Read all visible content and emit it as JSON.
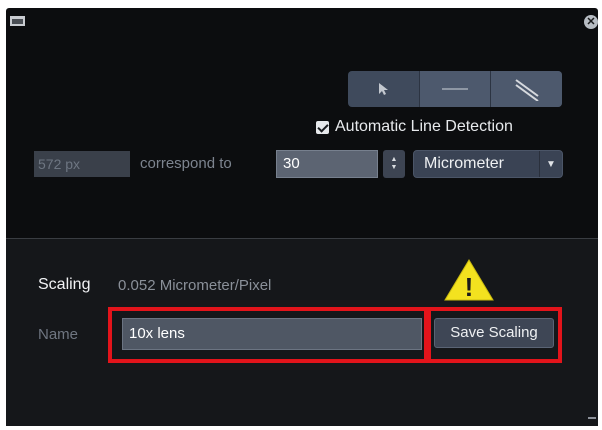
{
  "titlebar": {
    "window_icon": "window-icon",
    "close_icon": "close-icon",
    "close_glyph": "✕"
  },
  "tools": [
    {
      "icon": "pointer-arrow-icon",
      "selected": false
    },
    {
      "icon": "line-icon",
      "selected": true
    },
    {
      "icon": "parallel-lines-icon",
      "selected": true
    }
  ],
  "auto_line_detection": {
    "label": "Automatic Line Detection",
    "checked": true
  },
  "measurement": {
    "pixel_value": "572 px",
    "correspond_label": "correspond to",
    "length_value": "30",
    "unit_selected": "Micrometer"
  },
  "scaling": {
    "label": "Scaling",
    "value": "0.052 Micrometer/Pixel",
    "warning_icon": "warning-triangle-icon",
    "warning_glyph": "!"
  },
  "name": {
    "label": "Name",
    "value": "10x lens"
  },
  "save_button_label": "Save Scaling",
  "colors": {
    "panel_bg": "#0c0d0f",
    "highlight": "#e3141b",
    "warning_yellow": "#f3e21f"
  }
}
